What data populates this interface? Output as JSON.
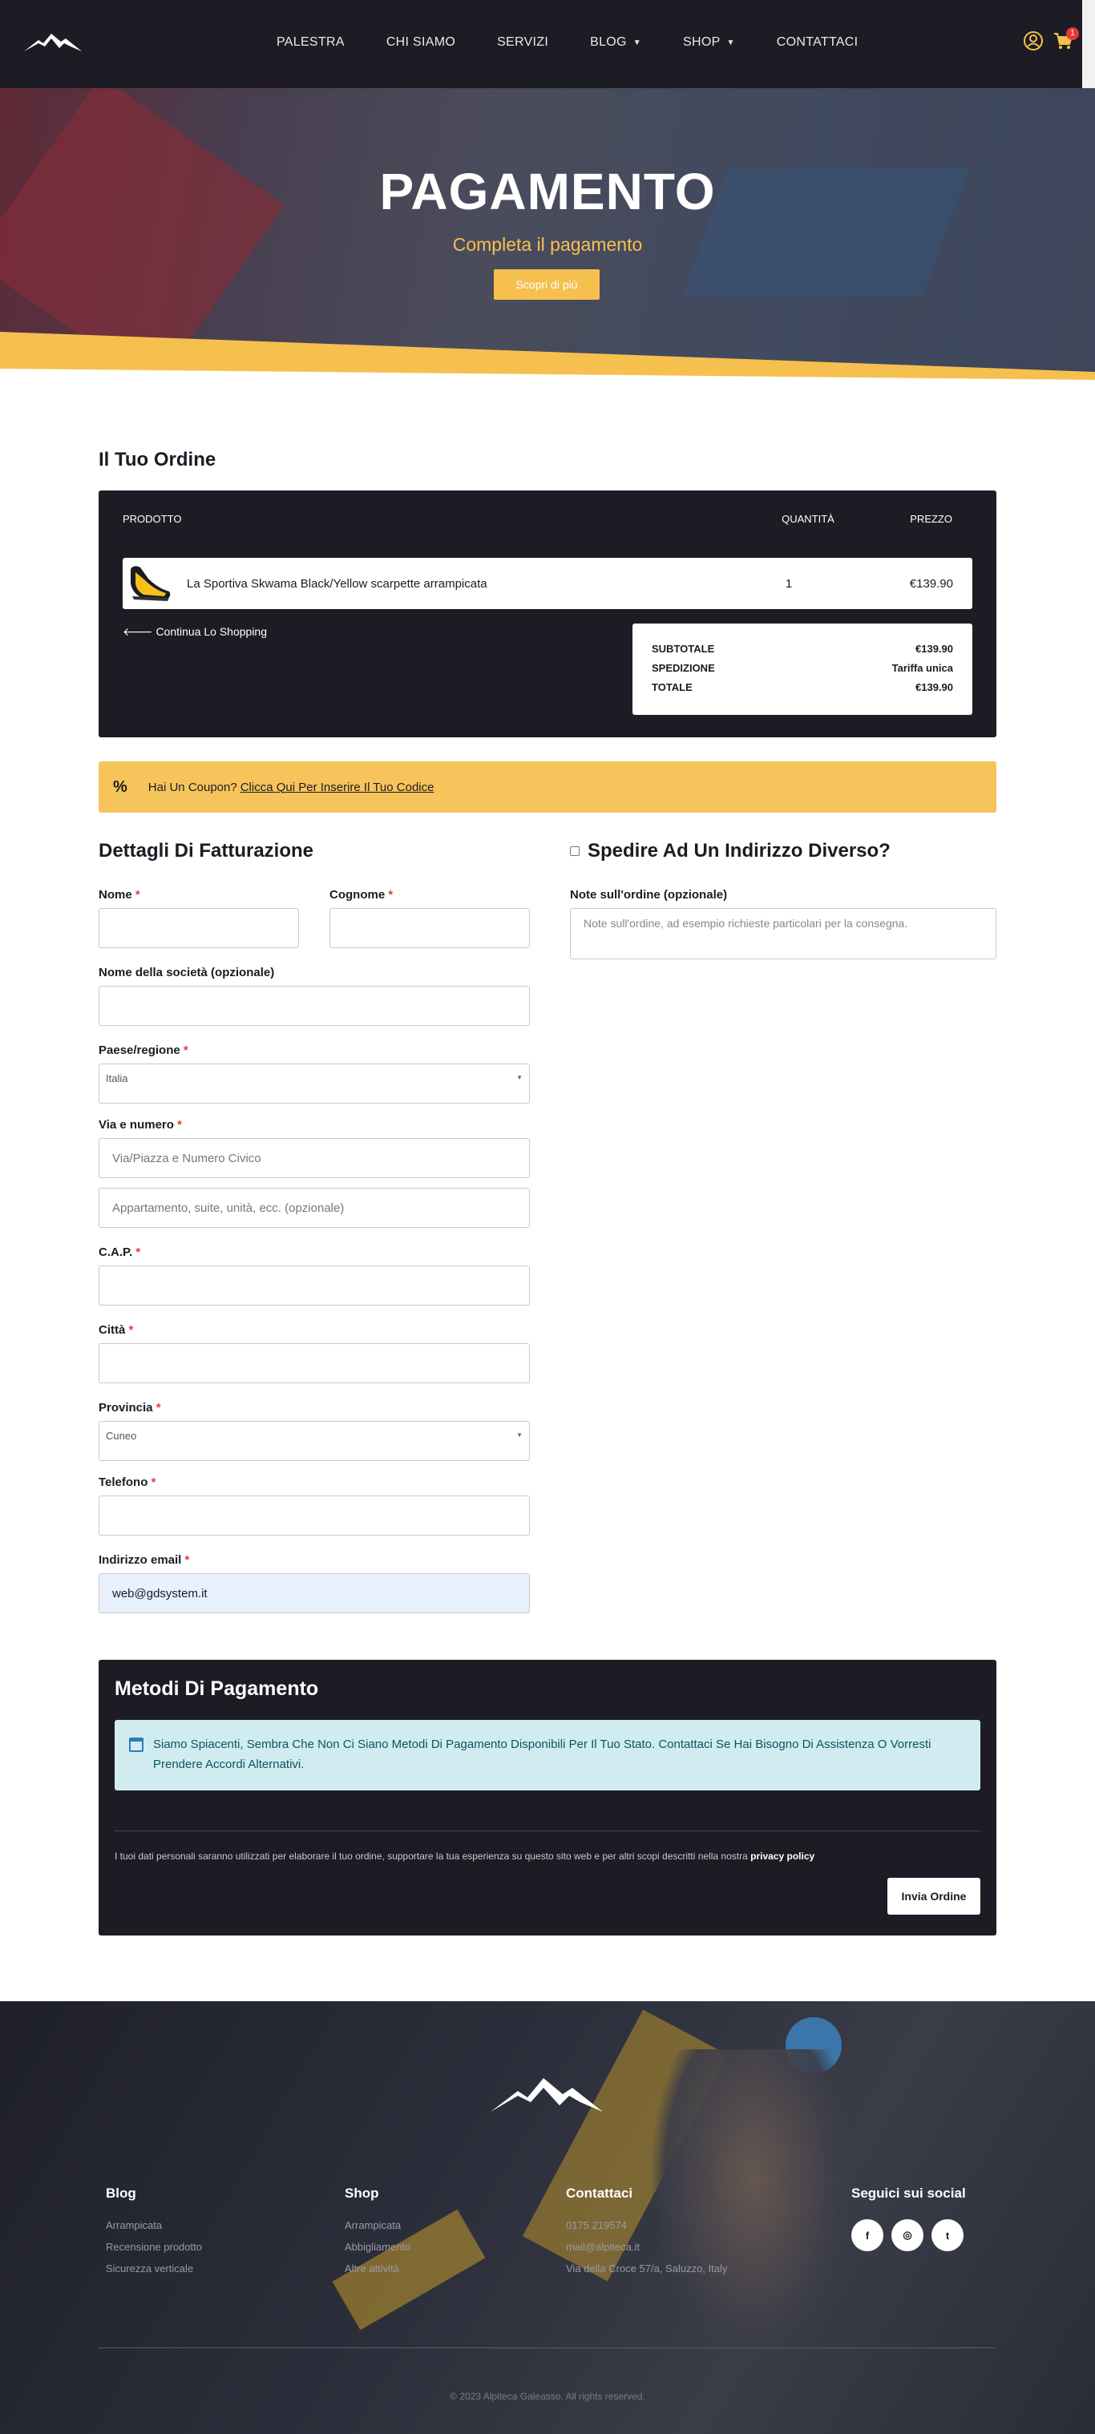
{
  "header": {
    "nav": [
      {
        "label": "PALESTRA"
      },
      {
        "label": "CHI SIAMO"
      },
      {
        "label": "SERVIZI"
      },
      {
        "label": "BLOG",
        "dropdown": true
      },
      {
        "label": "SHOP",
        "dropdown": true
      },
      {
        "label": "CONTATTACI"
      }
    ],
    "cart_count": "1",
    "icons": [
      "user-icon",
      "cart-icon"
    ]
  },
  "hero": {
    "title": "PAGAMENTO",
    "subtitle": "Completa il pagamento",
    "button": "Scopri di più"
  },
  "order": {
    "title": "Il Tuo Ordine",
    "columns": {
      "product": "PRODOTTO",
      "qty": "QUANTITÀ",
      "price": "PREZZO"
    },
    "item": {
      "name": "La Sportiva Skwama Black/Yellow scarpette arrampicata",
      "qty": "1",
      "price": "€139.90"
    },
    "continue": "Continua Lo Shopping",
    "totals": {
      "subtotal_label": "SUBTOTALE",
      "subtotal": "€139.90",
      "shipping_label": "SPEDIZIONE",
      "shipping": "Tariffa unica",
      "total_label": "TOTALE",
      "total": "€139.90"
    }
  },
  "coupon": {
    "text": "Hai Un Coupon?",
    "link": "Clicca Qui Per Inserire Il Tuo Codice"
  },
  "billing": {
    "title": "Dettagli Di Fatturazione",
    "nome": "Nome",
    "cognome": "Cognome",
    "societa": "Nome della società (opzionale)",
    "paese": "Paese/regione",
    "paese_value": "Italia",
    "via": "Via e numero",
    "via_placeholder": "Via/Piazza e Numero Civico",
    "via2_placeholder": "Appartamento, suite, unità, ecc. (opzionale)",
    "cap": "C.A.P.",
    "citta": "Città",
    "provincia": "Provincia",
    "provincia_value": "Cuneo",
    "telefono": "Telefono",
    "email": "Indirizzo email",
    "email_value": "web@gdsystem.it",
    "required_mark": "*"
  },
  "shipping": {
    "title": "Spedire Ad Un Indirizzo Diverso?",
    "notes_label": "Note sull'ordine (opzionale)",
    "notes_placeholder": "Note sull'ordine, ad esempio richieste particolari per la consegna."
  },
  "payment": {
    "title": "Metodi Di Pagamento",
    "notice": "Siamo Spiacenti, Sembra Che Non Ci Siano Metodi Di Pagamento Disponibili Per Il Tuo Stato. Contattaci Se Hai Bisogno Di Assistenza O Vorresti Prendere Accordi Alternativi.",
    "privacy": "I tuoi dati personali saranno utilizzati per elaborare il tuo ordine, supportare la tua esperienza su questo sito web e per altri scopi descritti nella nostra",
    "privacy_link": "privacy policy",
    "button": "Invia Ordine"
  },
  "footer": {
    "blog": {
      "title": "Blog",
      "links": [
        "Arrampicata",
        "Recensione prodotto",
        "Sicurezza verticale"
      ]
    },
    "shop": {
      "title": "Shop",
      "links": [
        "Arrampicata",
        "Abbigliamento",
        "Altre attività"
      ]
    },
    "contact": {
      "title": "Contattaci",
      "links": [
        "0175 219574",
        "mail@alpiteca.it",
        "Via della Croce 57/a, Saluzzo, Italy"
      ]
    },
    "social": {
      "title": "Seguici sui social",
      "icons": [
        "f",
        "◎",
        "t"
      ]
    },
    "copyright": "© 2023 Alpiteca Galeasso. All rights reserved."
  },
  "colors": {
    "accent": "#f6c04f",
    "dark": "#1d1c25",
    "notice_bg": "#d1ecf1"
  }
}
